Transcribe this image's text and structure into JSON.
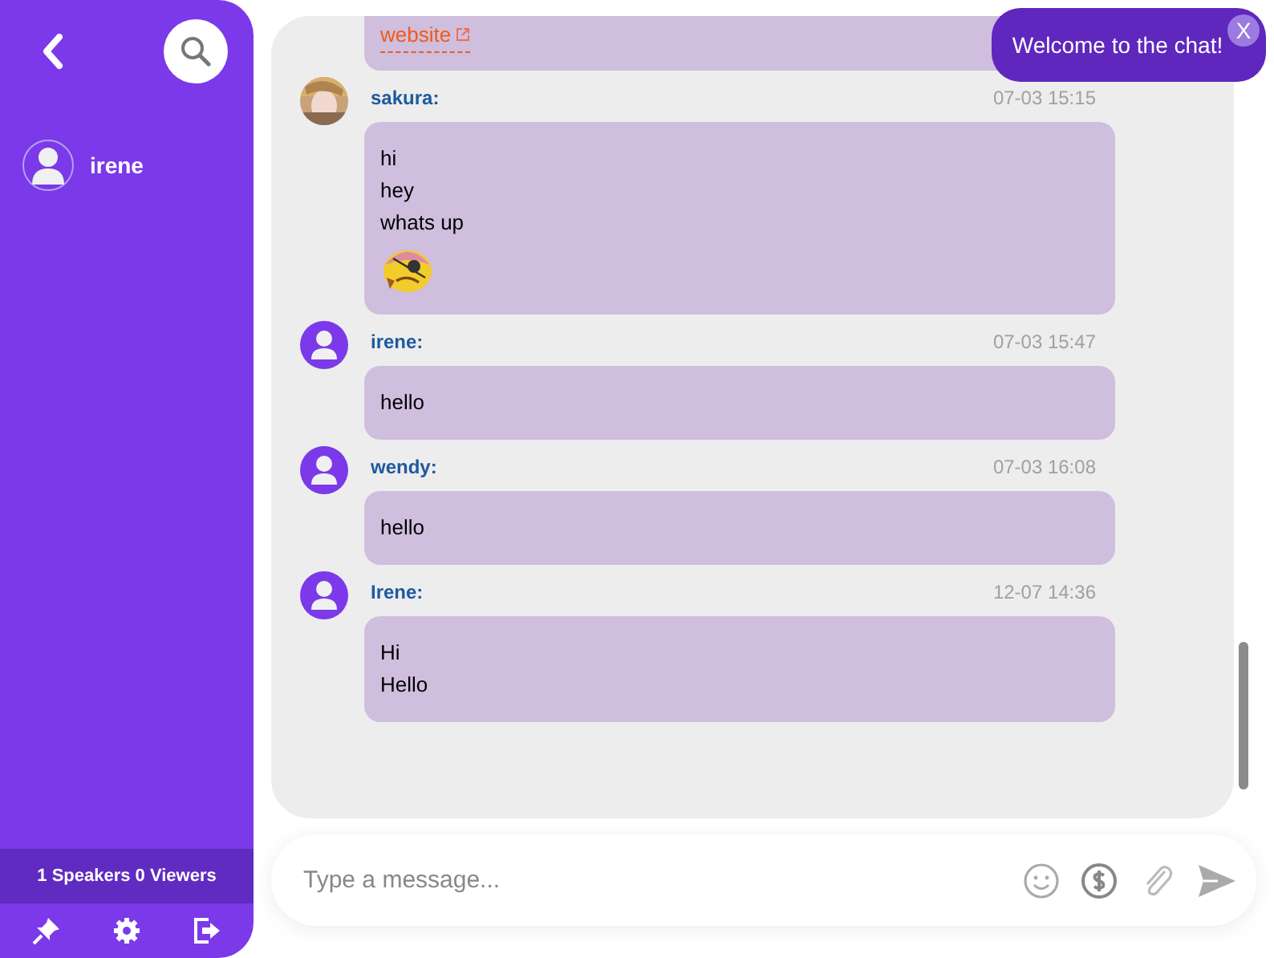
{
  "sidebar": {
    "users": [
      {
        "name": "irene"
      }
    ],
    "stats": "1 Speakers 0 Viewers"
  },
  "toast": {
    "text": "Welcome to the chat!",
    "close": "X"
  },
  "messages": [
    {
      "kind": "partial",
      "link": "website"
    },
    {
      "kind": "photo_message",
      "sender": "sakura:",
      "time": "07-03 15:15",
      "lines": [
        "hi",
        "hey",
        "whats up"
      ],
      "sticker": true
    },
    {
      "kind": "message",
      "sender": "irene:",
      "time": "07-03 15:47",
      "lines": [
        "hello"
      ],
      "sticker": false
    },
    {
      "kind": "message",
      "sender": "wendy:",
      "time": "07-03 16:08",
      "lines": [
        "hello"
      ],
      "sticker": false
    },
    {
      "kind": "message",
      "sender": "Irene:",
      "time": "12-07 14:36",
      "lines": [
        "Hi",
        "Hello"
      ],
      "sticker": false
    }
  ],
  "composer": {
    "placeholder": "Type a message..."
  }
}
